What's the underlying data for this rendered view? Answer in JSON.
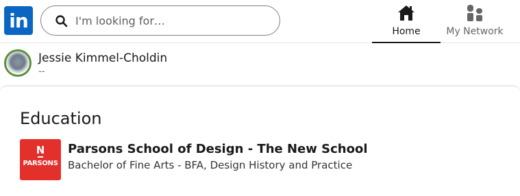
{
  "nav": {
    "logo_text": "in",
    "search": {
      "placeholder": "I'm looking for…"
    },
    "items": [
      {
        "label": "Home",
        "icon": "home-icon",
        "active": true
      },
      {
        "label": "My Network",
        "icon": "my-network-icon",
        "active": false
      }
    ]
  },
  "profile": {
    "name": "Jessie Kimmel-Choldin",
    "subtitle": "--"
  },
  "education": {
    "title": "Education",
    "entries": [
      {
        "school": "Parsons School of Design - The New School",
        "degree": "Bachelor of Fine Arts - BFA, Design History and Practice",
        "logo_mark": "N",
        "logo_text": "PARSONS",
        "logo_color": "#e4302a"
      }
    ]
  },
  "colors": {
    "brand": "#0a66c2",
    "text_primary": "#191919",
    "text_secondary": "#666666"
  }
}
